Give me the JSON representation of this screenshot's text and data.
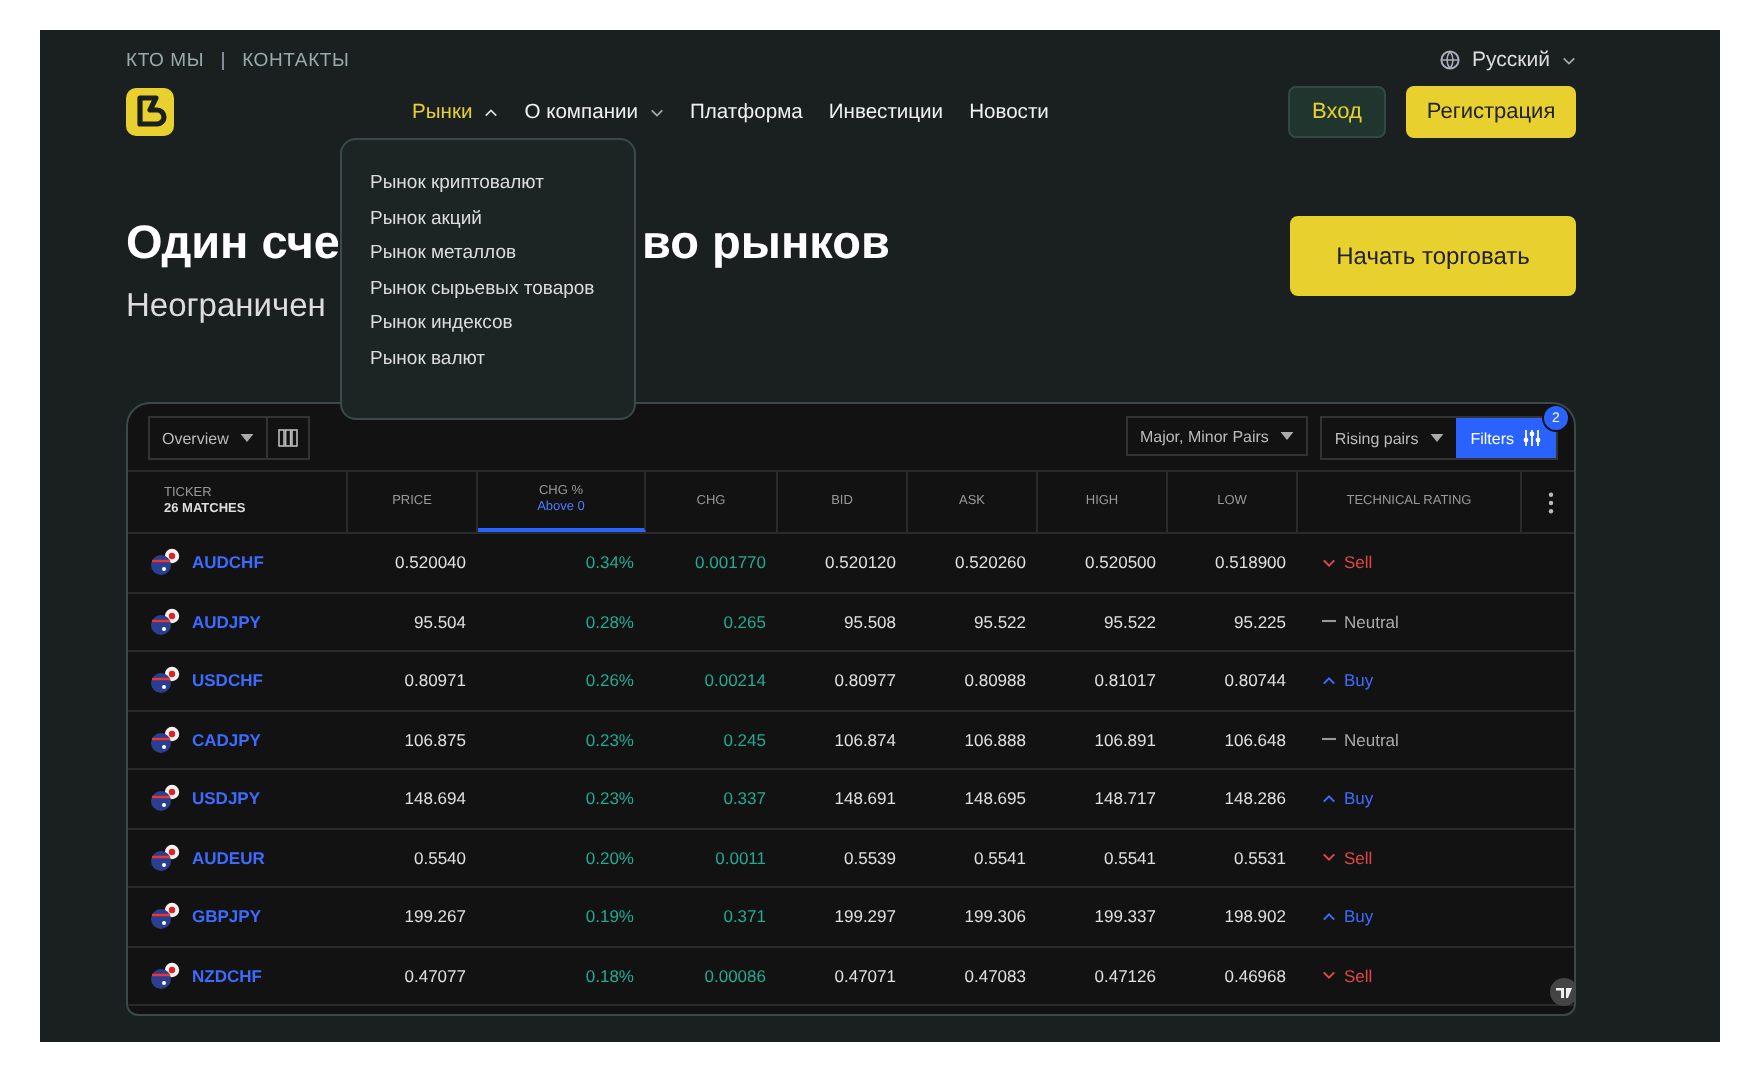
{
  "top_links": [
    "КТО МЫ",
    "КОНТАКТЫ"
  ],
  "language": "Русский",
  "nav": [
    {
      "label": "Рынки",
      "selected": true,
      "has_menu": true
    },
    {
      "label": "О компании",
      "selected": false,
      "has_menu": true
    },
    {
      "label": "Платформа",
      "selected": false,
      "has_menu": false
    },
    {
      "label": "Инвестиции",
      "selected": false,
      "has_menu": false
    },
    {
      "label": "Новости",
      "selected": false,
      "has_menu": false
    }
  ],
  "login_button": "Вход",
  "register_button": "Регистрация",
  "markets_menu": [
    "Рынок криптовалют",
    "Рынок акций",
    "Рынок металлов",
    "Рынок сырьевых товаров",
    "Рынок индексов",
    "Рынок валют"
  ],
  "headline_parts": [
    "Один сче",
    "во рынков"
  ],
  "subtitle": "Неограничен",
  "cta_button": "Начать торговать",
  "screener": {
    "view_select": "Overview",
    "filter_select": "Major, Minor Pairs",
    "sort_select": "Rising pairs",
    "filters_button": "Filters",
    "filters_badge": "2",
    "columns": [
      {
        "label": "TICKER",
        "sublabel": "26 MATCHES",
        "selected": false
      },
      {
        "label": "PRICE",
        "selected": false
      },
      {
        "label": "CHG %",
        "sublabel": "Above 0",
        "selected": true
      },
      {
        "label": "CHG",
        "selected": false
      },
      {
        "label": "BID",
        "selected": false
      },
      {
        "label": "ASK",
        "selected": false
      },
      {
        "label": "HIGH",
        "selected": false
      },
      {
        "label": "LOW",
        "selected": false
      },
      {
        "label": "TECHNICAL RATING",
        "selected": false
      }
    ],
    "rows": [
      {
        "ticker": "AUDCHF",
        "price": "0.520040",
        "chg_pct": "0.34%",
        "chg": "0.001770",
        "bid": "0.520120",
        "ask": "0.520260",
        "high": "0.520500",
        "low": "0.518900",
        "rating": "Sell",
        "kind": "sell"
      },
      {
        "ticker": "AUDJPY",
        "price": "95.504",
        "chg_pct": "0.28%",
        "chg": "0.265",
        "bid": "95.508",
        "ask": "95.522",
        "high": "95.522",
        "low": "95.225",
        "rating": "Neutral",
        "kind": "neutral"
      },
      {
        "ticker": "USDCHF",
        "price": "0.80971",
        "chg_pct": "0.26%",
        "chg": "0.00214",
        "bid": "0.80977",
        "ask": "0.80988",
        "high": "0.81017",
        "low": "0.80744",
        "rating": "Buy",
        "kind": "buy"
      },
      {
        "ticker": "CADJPY",
        "price": "106.875",
        "chg_pct": "0.23%",
        "chg": "0.245",
        "bid": "106.874",
        "ask": "106.888",
        "high": "106.891",
        "low": "106.648",
        "rating": "Neutral",
        "kind": "neutral"
      },
      {
        "ticker": "USDJPY",
        "price": "148.694",
        "chg_pct": "0.23%",
        "chg": "0.337",
        "bid": "148.691",
        "ask": "148.695",
        "high": "148.717",
        "low": "148.286",
        "rating": "Buy",
        "kind": "buy"
      },
      {
        "ticker": "AUDEUR",
        "price": "0.5540",
        "chg_pct": "0.20%",
        "chg": "0.0011",
        "bid": "0.5539",
        "ask": "0.5541",
        "high": "0.5541",
        "low": "0.5531",
        "rating": "Sell",
        "kind": "sell"
      },
      {
        "ticker": "GBPJPY",
        "price": "199.267",
        "chg_pct": "0.19%",
        "chg": "0.371",
        "bid": "199.297",
        "ask": "199.306",
        "high": "199.337",
        "low": "198.902",
        "rating": "Buy",
        "kind": "buy"
      },
      {
        "ticker": "NZDCHF",
        "price": "0.47077",
        "chg_pct": "0.18%",
        "chg": "0.00086",
        "bid": "0.47071",
        "ask": "0.47083",
        "high": "0.47126",
        "low": "0.46968",
        "rating": "Sell",
        "kind": "sell"
      }
    ]
  }
}
